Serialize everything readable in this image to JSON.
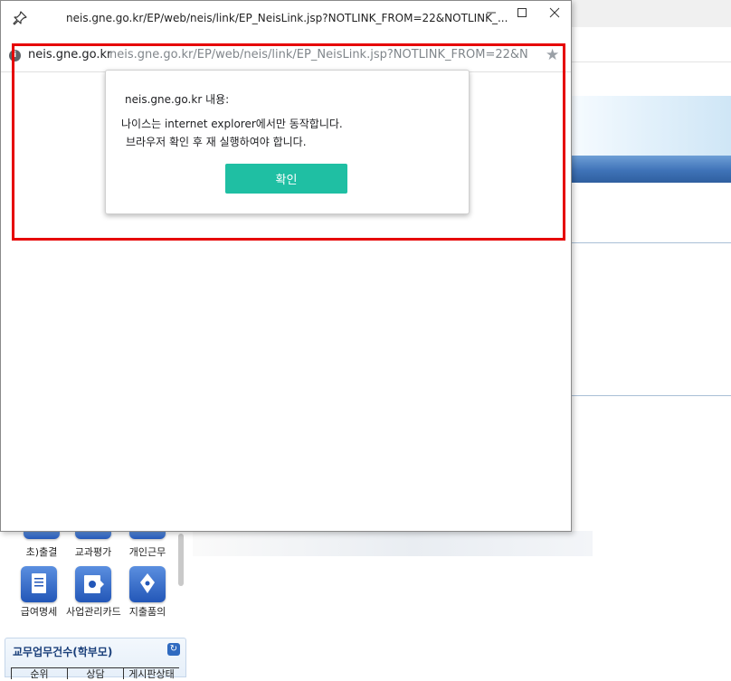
{
  "popup": {
    "title": "neis.gne.go.kr/EP/web/neis/link/EP_NeisLink.jsp?NOTLINK_FROM=22&NOTLINK_...",
    "url_host": "neis.gne.go.kr",
    "url_path": "neis.gne.go.kr/EP/web/neis/link/EP_NeisLink.jsp?NOTLINK_FROM=22&NO",
    "icons": {
      "pin": "pin-icon",
      "info": "info-icon",
      "star": "star-icon"
    }
  },
  "dialog": {
    "origin": "neis.gne.go.kr 내용:",
    "message_line1": "나이스는 internet explorer에서만 동작합니다.",
    "message_line2": "브라우저 확인 후 재 실행하여야 합니다.",
    "ok_label": "확인",
    "ok_color": "#1fbfa3"
  },
  "background": {
    "shortcuts": [
      {
        "label": "초)출결"
      },
      {
        "label": "교과평가"
      },
      {
        "label": "개인근무"
      },
      {
        "label": "급여명세"
      },
      {
        "label": "사업관리카드"
      },
      {
        "label": "지출품의"
      }
    ],
    "panel": {
      "title": "교무업무건수(학부모)",
      "columns": [
        "순위",
        "상담",
        "게시판상태"
      ]
    }
  },
  "colors": {
    "highlight_frame": "#e60000",
    "header_blue": "#3f73b8"
  }
}
